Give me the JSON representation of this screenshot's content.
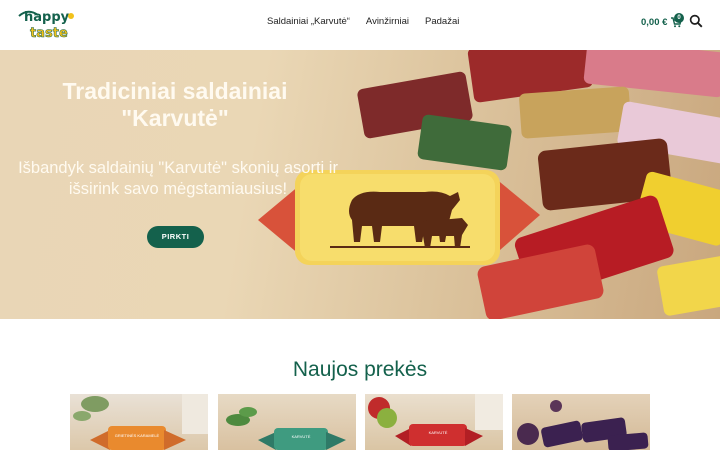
{
  "header": {
    "logo_text_1": "happy",
    "logo_text_2": "taste",
    "nav": [
      "Saldainiai „Karvutė“",
      "Avinžirniai",
      "Padažai"
    ],
    "cart_price": "0,00 €",
    "cart_count": "0",
    "icons": {
      "cart": "cart-icon",
      "search": "search-icon"
    }
  },
  "hero": {
    "title_line1": "Tradiciniai saldainiai",
    "title_line2": "\"Karvutė\"",
    "subtitle_line1": "Išbandyk saldainių \"Karvutė\" skonių asorti ir",
    "subtitle_line2": "išsirink savo mėgstamiausius!",
    "button": "PIRKTI",
    "candy_wrapper_label": "Karvutė"
  },
  "new_products": {
    "title": "Naujos prekės",
    "items": [
      {
        "wrapper_text": "GRIETINĖS KARAMELĖ"
      },
      {
        "wrapper_text": "KARVUTĖ"
      },
      {
        "wrapper_text": "KARVUTĖ"
      },
      {
        "wrapper_text": ""
      }
    ]
  },
  "colors": {
    "brand_green": "#14614c",
    "logo_yellow": "#f2c21b"
  }
}
